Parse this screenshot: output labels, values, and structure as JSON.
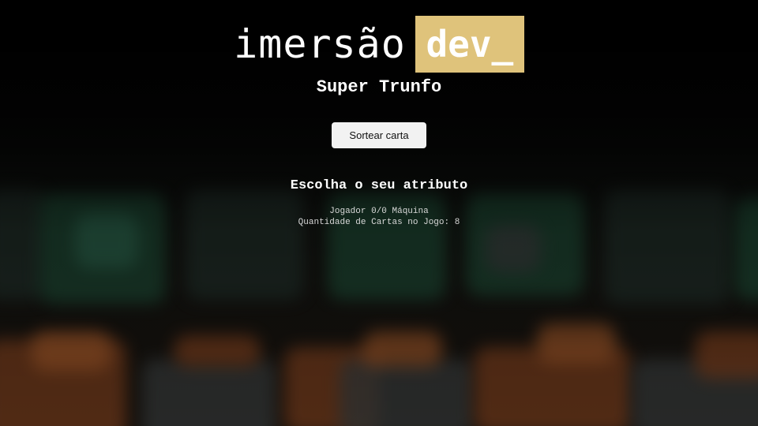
{
  "logo": {
    "word": "imersão",
    "highlight": "dev_",
    "highlight_color": "#dfc37b"
  },
  "title": "Super Trunfo",
  "draw_button": {
    "label": "Sortear carta"
  },
  "attribute_heading": "Escolha o seu atributo",
  "score": {
    "line": "Jogador 0/0 Máquina",
    "cards_in_game": "Quantidade de Cartas no Jogo: 8"
  }
}
